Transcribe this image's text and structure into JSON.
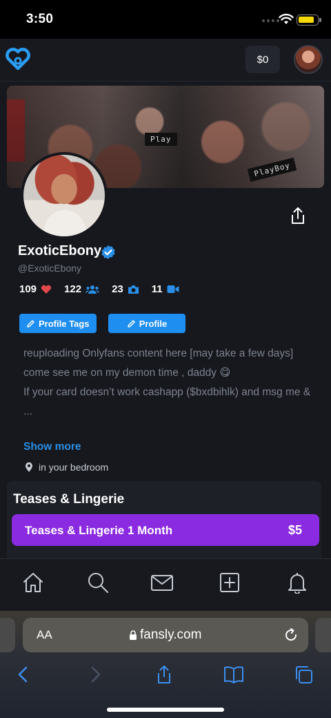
{
  "status_bar": {
    "time": "3:50"
  },
  "header": {
    "balance": "$0"
  },
  "banner": {
    "label_play": "Play",
    "label_playboy": "PlayBoy"
  },
  "profile": {
    "display_name": "ExoticEbony",
    "handle": "@ExoticEbony",
    "stats": {
      "likes": "109",
      "subscribers": "122",
      "photos": "23",
      "videos": "11"
    },
    "buttons": {
      "profile_tags": "Profile Tags",
      "profile": "Profile"
    },
    "bio": [
      "reuploading Onlyfans content here  [may take a few days]",
      "come see me on my demon time , daddy 😋",
      "If your card doesn’t work cashapp ($bxdbihlk) and msg me & ..."
    ],
    "show_more": "Show more",
    "location": "in your bedroom"
  },
  "tiers": {
    "title": "Teases & Lingerie",
    "items": [
      {
        "name": "Teases & Lingerie 1 Month",
        "price": "$5"
      }
    ]
  },
  "browser": {
    "text_size_label": "AA",
    "url": "fansly.com"
  },
  "colors": {
    "accent_blue": "#1e8ef0",
    "tier_purple": "#8a2be2",
    "heart_red": "#e0484a"
  }
}
